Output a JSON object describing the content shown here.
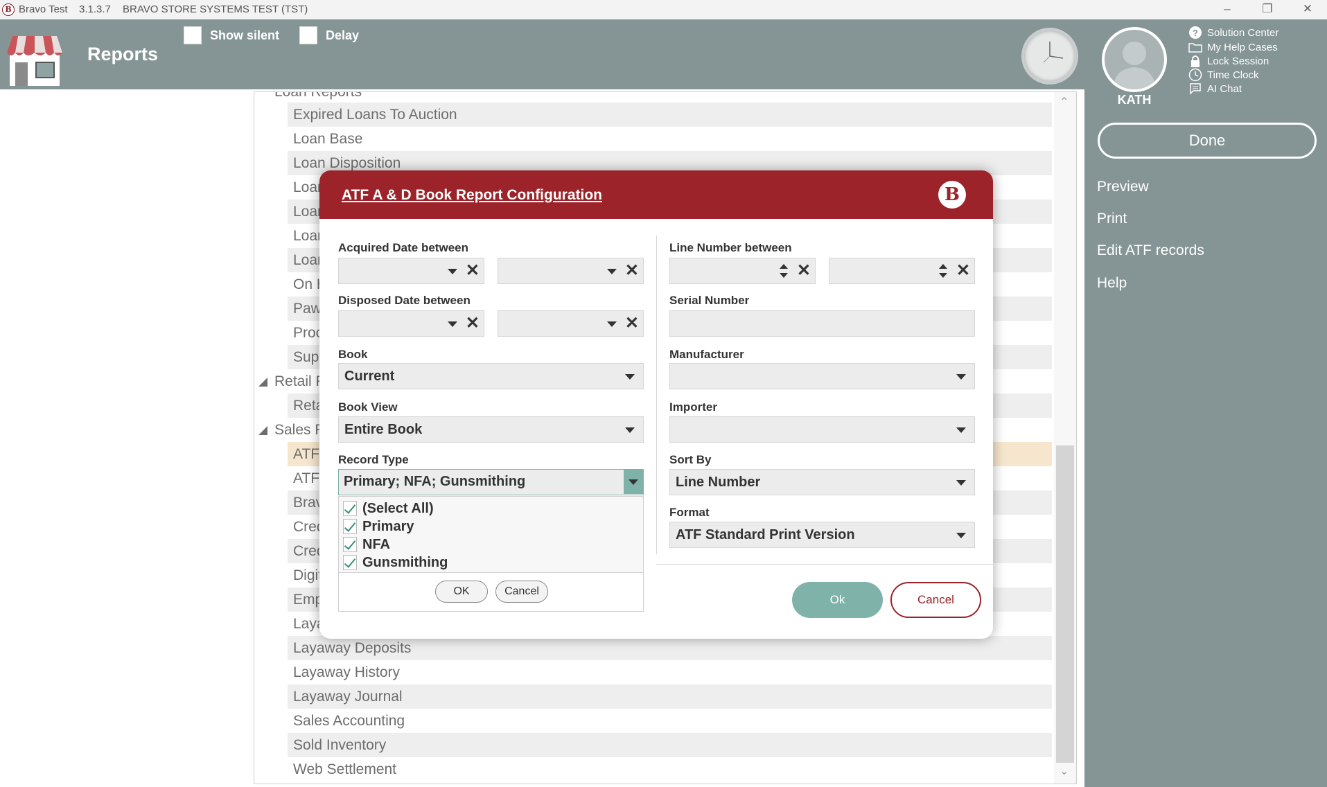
{
  "titlebar": {
    "app_name": "Bravo Test",
    "version": "3.1.3.7",
    "system": "BRAVO STORE SYSTEMS TEST (TST)",
    "logo_letter": "B"
  },
  "header": {
    "title": "Reports",
    "show_silent_label": "Show silent",
    "delay_label": "Delay"
  },
  "user": {
    "name": "KATH"
  },
  "top_links": [
    {
      "label": "Solution Center",
      "icon": "question-circle-icon"
    },
    {
      "label": "My Help Cases",
      "icon": "folder-icon"
    },
    {
      "label": "Lock Session",
      "icon": "lock-icon"
    },
    {
      "label": "Time Clock",
      "icon": "clock-icon"
    },
    {
      "label": "AI Chat",
      "icon": "chat-icon"
    }
  ],
  "side": {
    "done_label": "Done",
    "links": [
      "Preview",
      "Print",
      "Edit ATF records",
      "Help"
    ]
  },
  "reports": {
    "partial_group": "Loan Reports",
    "loan_items": [
      "Expired Loans To Auction",
      "Loan Base",
      "Loan Disposition",
      "Loan",
      "Loan",
      "Loan",
      "Loan",
      "On H",
      "Pawr",
      "Proc",
      "Supp"
    ],
    "retail_group": "Retail R",
    "retail_items": [
      "Retai"
    ],
    "sales_group": "Sales Re",
    "sales_items": [
      "ATF A",
      "ATF A",
      "Bravo",
      "Cred",
      "Cred",
      "Digit",
      "Empl",
      "Layav",
      "Layaway Deposits",
      "Layaway History",
      "Layaway Journal",
      "Sales Accounting",
      "Sold Inventory",
      "Web Settlement"
    ]
  },
  "dialog": {
    "title": "ATF A & D Book Report Configuration",
    "logo_letter": "B",
    "acquired_date_label": "Acquired Date between",
    "disposed_date_label": "Disposed Date between",
    "book_label": "Book",
    "book_value": "Current",
    "book_view_label": "Book View",
    "book_view_value": "Entire Book",
    "record_type_label": "Record Type",
    "record_type_value": "Primary; NFA; Gunsmithing",
    "record_type_options": [
      "(Select All)",
      "Primary",
      "NFA",
      "Gunsmithing"
    ],
    "popup_ok": "OK",
    "popup_cancel": "Cancel",
    "line_number_label": "Line Number between",
    "serial_number_label": "Serial Number",
    "manufacturer_label": "Manufacturer",
    "importer_label": "Importer",
    "sort_by_label": "Sort By",
    "sort_by_value": "Line Number",
    "format_label": "Format",
    "format_value": "ATF Standard Print Version",
    "ok_label": "Ok",
    "cancel_label": "Cancel"
  },
  "colors": {
    "header_bg": "#859495",
    "dialog_header": "#9b2329",
    "accent_teal": "#7fb3aa",
    "selected_row": "#f6e6cd"
  }
}
